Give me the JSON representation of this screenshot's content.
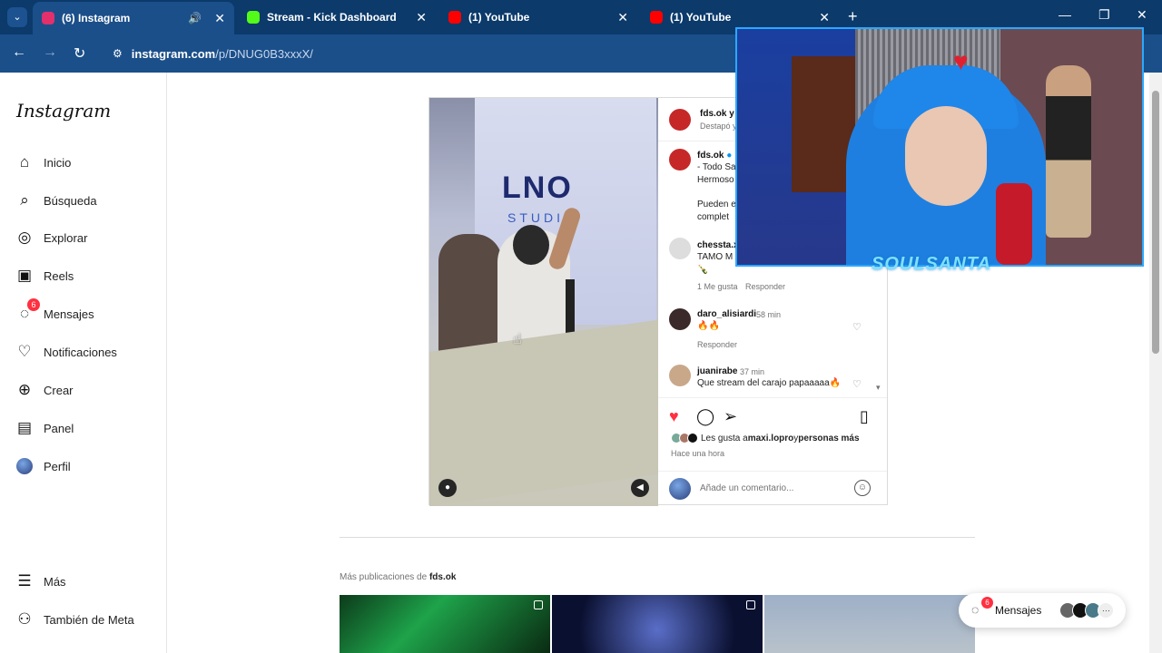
{
  "browser": {
    "tabs": [
      {
        "title": "(6) Instagram",
        "active": true,
        "favicon_color": "#e1306c"
      },
      {
        "title": "Stream - Kick Dashboard",
        "active": false,
        "favicon_color": "#53fc18"
      },
      {
        "title": "(1) YouTube",
        "active": false,
        "favicon_color": "#ff0000"
      },
      {
        "title": "(1) YouTube",
        "active": false,
        "favicon_color": "#ff0000"
      }
    ],
    "url_domain": "instagram.com",
    "url_path": "/p/DNUG0B3xxxX/"
  },
  "sidebar": {
    "logo": "Instagram",
    "items": [
      {
        "label": "Inicio",
        "icon": "home-icon"
      },
      {
        "label": "Búsqueda",
        "icon": "search-icon"
      },
      {
        "label": "Explorar",
        "icon": "compass-icon"
      },
      {
        "label": "Reels",
        "icon": "reels-icon"
      },
      {
        "label": "Mensajes",
        "icon": "messenger-icon",
        "badge": "6"
      },
      {
        "label": "Notificaciones",
        "icon": "heart-icon"
      },
      {
        "label": "Crear",
        "icon": "plus-icon"
      },
      {
        "label": "Panel",
        "icon": "chart-icon"
      },
      {
        "label": "Perfil",
        "icon": "avatar"
      }
    ],
    "bottom": [
      {
        "label": "Más",
        "icon": "menu-icon"
      },
      {
        "label": "También de Meta",
        "icon": "meta-icon"
      }
    ]
  },
  "post": {
    "header_user": "fds.ok y",
    "header_sub": "Destapó y",
    "media_text_1": "LNO",
    "media_text_2": "STUDIO",
    "caption_user": "fds.ok",
    "caption_lines": [
      "- Todo Sa",
      "Hermoso",
      "",
      "Pueden e",
      "complet"
    ],
    "comments": [
      {
        "user": "chessta.x",
        "time": "",
        "text": "TAMO M",
        "extra": "🍾",
        "likes": "1 Me gusta",
        "reply": "Responder"
      },
      {
        "user": "daro_alisiardi",
        "time": "58 min",
        "text": "🔥🔥",
        "reply": "Responder"
      },
      {
        "user": "juanirabe",
        "time": "37 min",
        "text": "Que stream del carajo papaaaaa🔥"
      }
    ],
    "likes_text_pre": "Les gusta a ",
    "likes_user": "maxi.lopro",
    "likes_text_mid": " y ",
    "likes_more": "personas más",
    "time_ago": "Hace una hora",
    "comment_placeholder": "Añade un comentario..."
  },
  "more": {
    "label_pre": "Más publicaciones de ",
    "label_user": "fds.ok"
  },
  "messages_pill": {
    "label": "Mensajes",
    "badge": "6"
  },
  "overlay": {
    "logo_text": "SOULSANTA"
  }
}
